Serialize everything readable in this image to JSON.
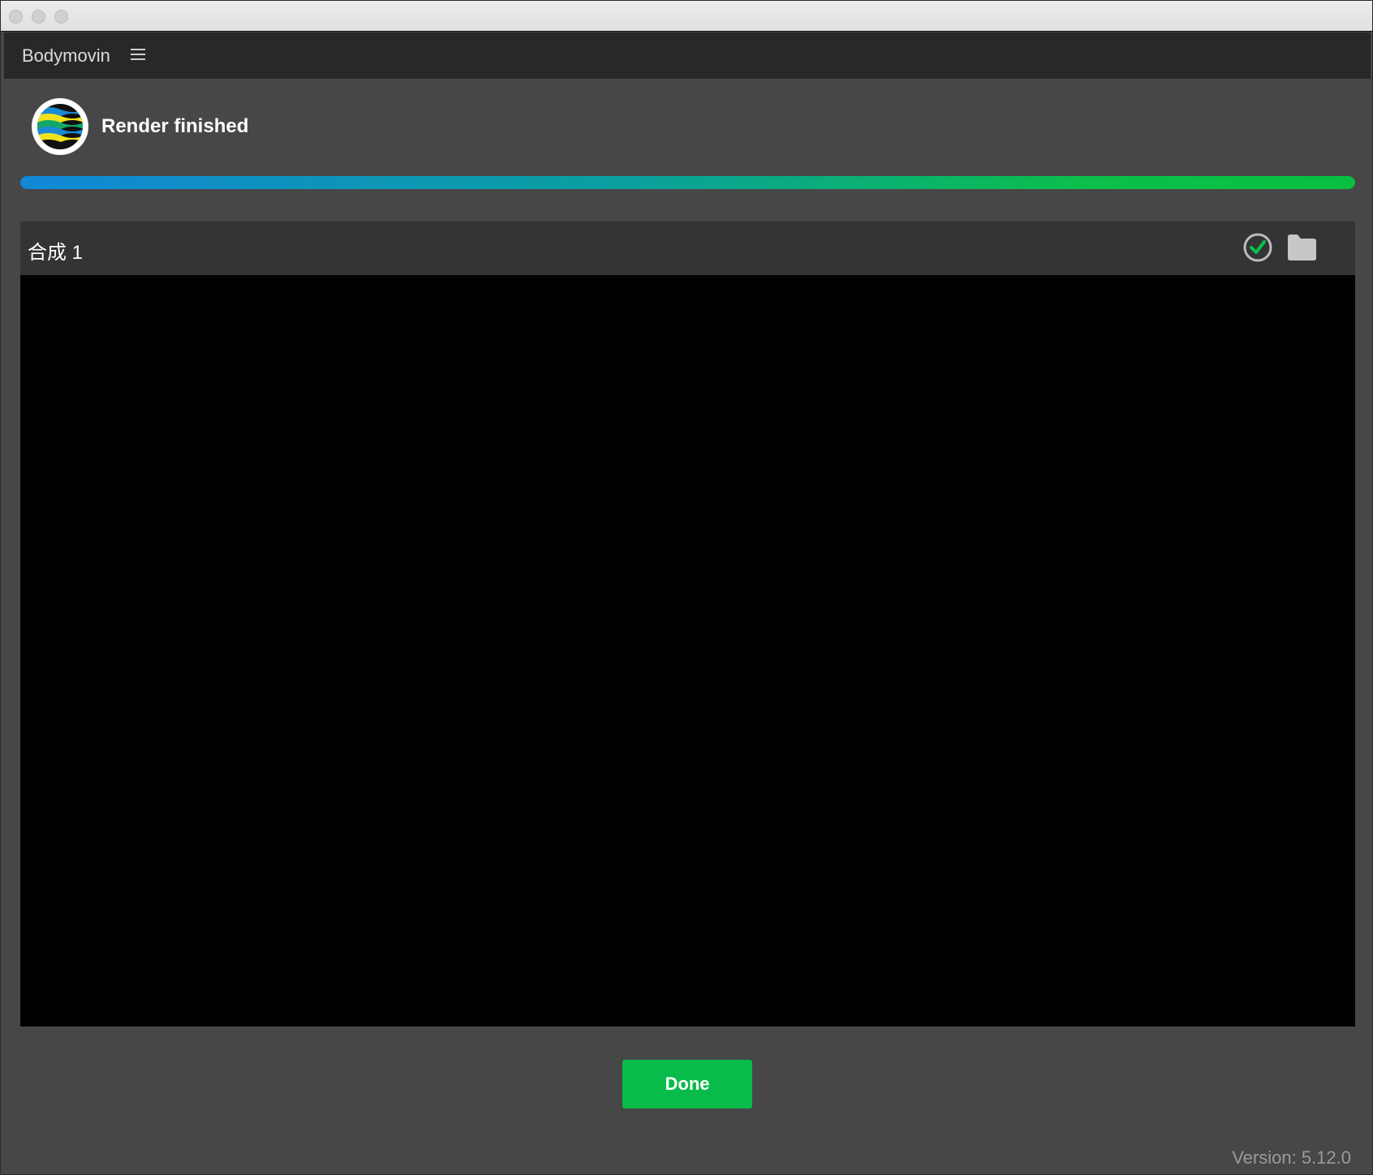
{
  "window": {
    "traffic_lights": [
      "close",
      "minimize",
      "zoom"
    ]
  },
  "panel": {
    "title": "Bodymovin",
    "menu_icon": "hamburger-menu-icon"
  },
  "render": {
    "logo_icon": "bodymovin-logo",
    "status": "Render finished",
    "progress_fraction": 1.0,
    "progress_gradient": [
      "#1188d8",
      "#0aa0a0",
      "#0bbf4a"
    ]
  },
  "composition": {
    "name": "合成 1",
    "status_icon": "check-circle-icon",
    "status_color": "#0bbf4a",
    "folder_icon": "folder-icon"
  },
  "footer": {
    "done_label": "Done",
    "done_color": "#09bb4a",
    "version": "Version: 5.12.0"
  }
}
